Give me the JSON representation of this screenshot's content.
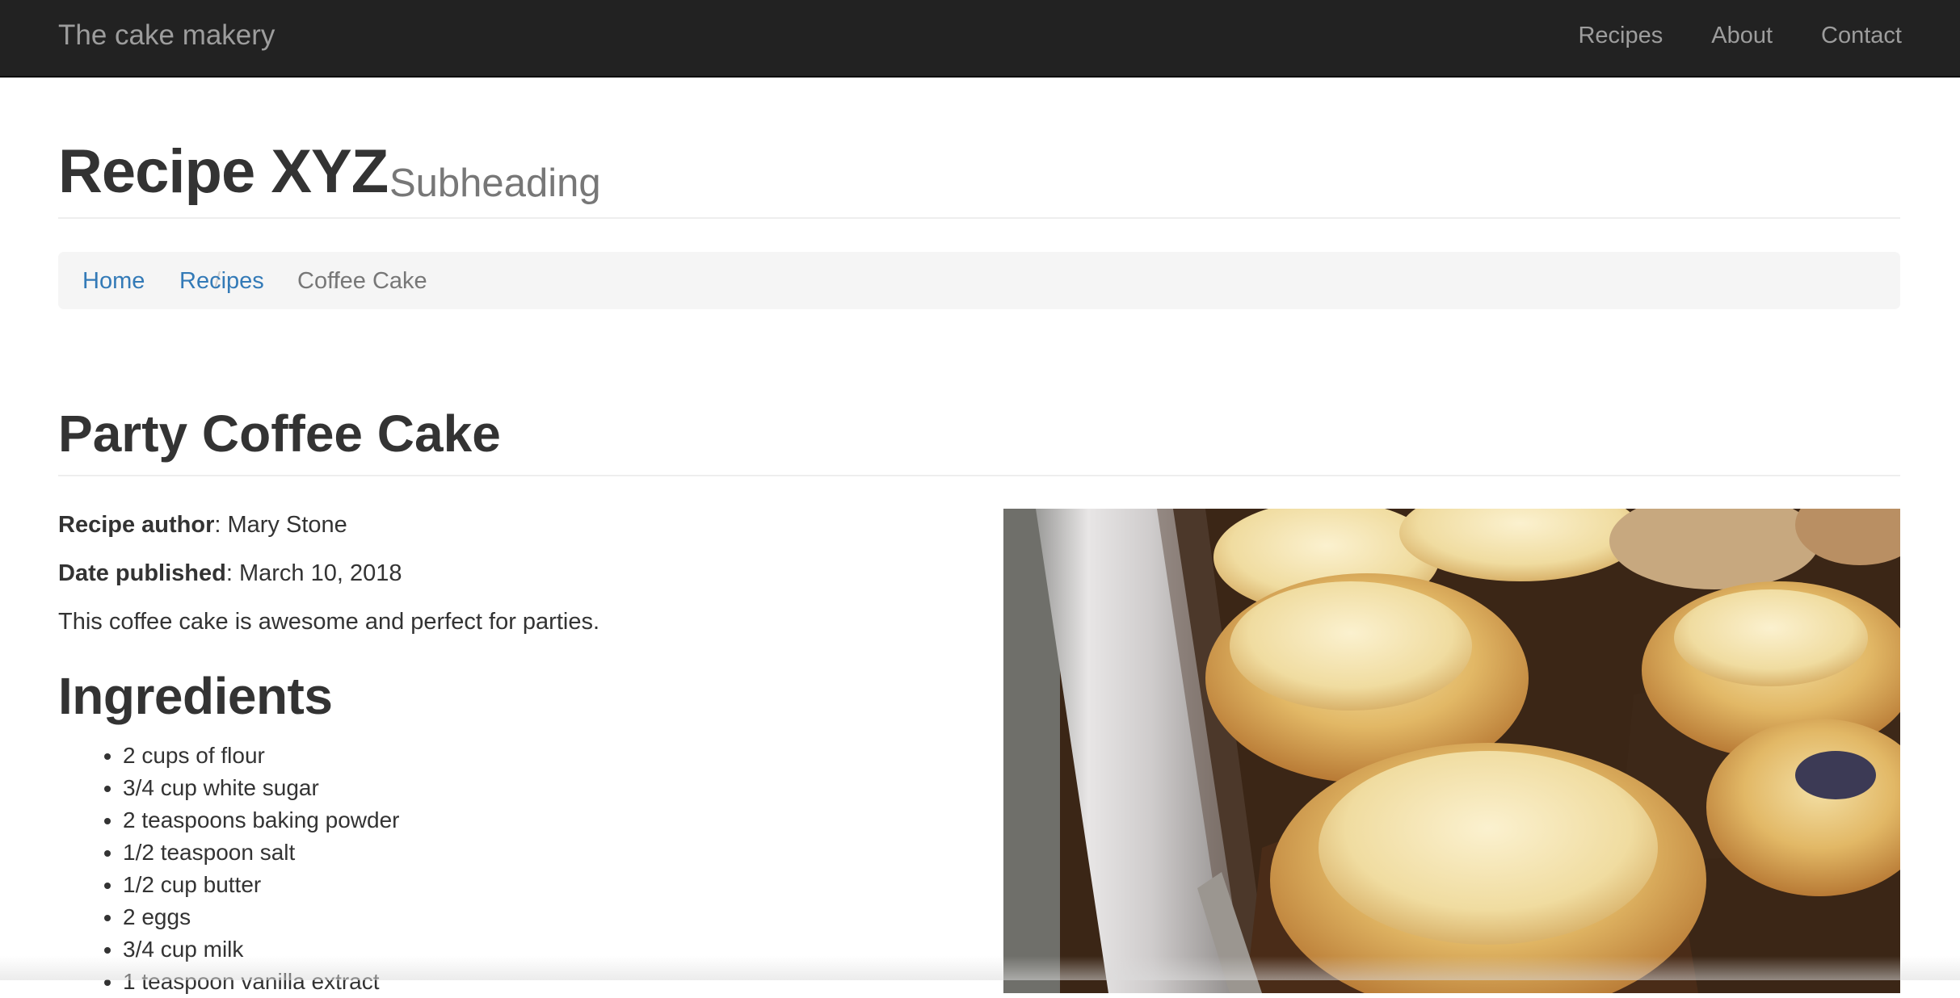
{
  "navbar": {
    "brand": "The cake makery",
    "links": [
      "Recipes",
      "About",
      "Contact"
    ]
  },
  "header": {
    "title": "Recipe XYZ",
    "subtitle": "Subheading"
  },
  "breadcrumb": {
    "items": [
      "Home",
      "Recipes",
      "Coffee Cake"
    ],
    "separator": "/"
  },
  "recipe": {
    "title": "Party Coffee Cake",
    "author_label": "Recipe author",
    "author": ": Mary Stone",
    "date_label": "Date published",
    "date": ": March 10, 2018",
    "description": "This coffee cake is awesome and perfect for parties.",
    "ingredients_heading": "Ingredients",
    "ingredients": [
      "2 cups of flour",
      "3/4 cup white sugar",
      "2 teaspoons baking powder",
      "1/2 teaspoon salt",
      "1/2 cup butter",
      "2 eggs",
      "3/4 cup milk",
      "1 teaspoon vanilla extract"
    ]
  },
  "colors": {
    "navbar_bg": "#222222",
    "navbar_text": "#9d9d9d",
    "link": "#337ab7",
    "breadcrumb_bg": "#f5f5f5"
  }
}
